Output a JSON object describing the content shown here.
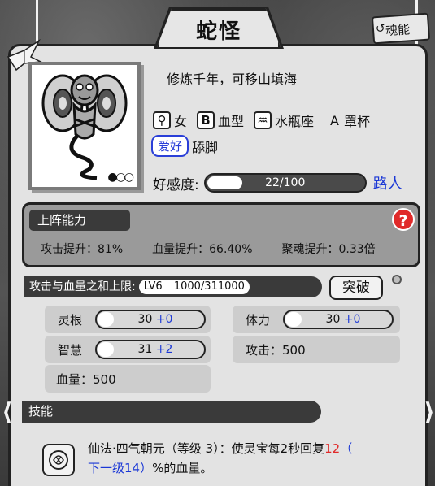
{
  "character": {
    "name": "蛇怪",
    "motto": "修炼千年，可移山填海"
  },
  "sign": {
    "label": "魂能"
  },
  "attributes": [
    {
      "icon": "female-symbol-icon",
      "glyph": "♀",
      "label": "女"
    },
    {
      "icon": "blood-type-icon",
      "glyph": "B",
      "label": "血型"
    },
    {
      "icon": "aquarius-icon",
      "glyph": "♒",
      "label": "水瓶座"
    },
    {
      "icon": "cup-size-icon",
      "glyph": "A",
      "label": "罩杯"
    }
  ],
  "hobby": {
    "tag": "爱好",
    "value": "舔脚"
  },
  "favor": {
    "label": "好感度:",
    "text": "22/100",
    "fraction": 0.22,
    "rank": "路人"
  },
  "battle": {
    "title": "上阵能力",
    "help": "?",
    "stats": [
      "攻击提升：81%",
      "血量提升：66.40%",
      "聚魂提升：0.33倍"
    ]
  },
  "cap": {
    "label": "攻击与血量之和上限:",
    "level": "LV6",
    "value": "1000/311000",
    "button": "突破"
  },
  "stats": {
    "lingen": {
      "label": "灵根",
      "base": "30",
      "bonus": "+0"
    },
    "tili": {
      "label": "体力",
      "base": "30",
      "bonus": "+0"
    },
    "zhihui": {
      "label": "智慧",
      "base": "31",
      "bonus": "+2"
    },
    "attack": {
      "text": "攻击：500"
    },
    "hp": {
      "text": "血量：500"
    }
  },
  "skills": {
    "title": "技能",
    "line1_a": "仙法·四气朝元（等级 3）：使灵宝每2秒回复",
    "line1_red": "12",
    "line1_paren": "（",
    "line2_blue": "下一级14）",
    "line2_rest": "%的血量。"
  },
  "colors": {
    "accent_blue": "#1a37d6",
    "accent_red": "#e02a2a"
  }
}
